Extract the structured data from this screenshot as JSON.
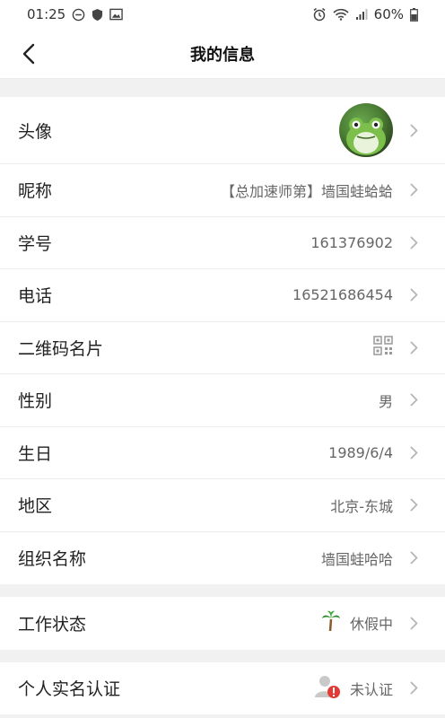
{
  "status_bar": {
    "time": "01:25",
    "battery": "60%",
    "icons_left": [
      "dnd-icon",
      "shield-icon",
      "image-icon"
    ],
    "icons_right": [
      "alarm-icon",
      "wifi-icon",
      "signal-icon",
      "battery-icon"
    ]
  },
  "nav": {
    "title": "我的信息",
    "back_icon": "chevron-left-icon"
  },
  "profile": {
    "avatar_label": "头像",
    "nickname_label": "昵称",
    "nickname_value": "【总加速师第】墙国蛙蛤蛤",
    "student_id_label": "学号",
    "student_id_value": "161376902",
    "phone_label": "电话",
    "phone_value": "16521686454",
    "qrcode_label": "二维码名片",
    "qrcode_icon": "qrcode-icon",
    "gender_label": "性别",
    "gender_value": "男",
    "birthday_label": "生日",
    "birthday_value": "1989/6/4",
    "region_label": "地区",
    "region_value": "北京-东城",
    "org_label": "组织名称",
    "org_value": "墙国蛙哈哈"
  },
  "work": {
    "label": "工作状态",
    "icon": "palm-tree-icon",
    "value": "休假中"
  },
  "verify": {
    "label": "个人实名认证",
    "icon": "user-alert-icon",
    "value": "未认证"
  },
  "colors": {
    "background": "#f1f1f1",
    "row_background": "#ffffff",
    "label_text": "#222222",
    "value_text": "#666666",
    "chevron": "#b5b5b5",
    "alert_red": "#e53935"
  }
}
